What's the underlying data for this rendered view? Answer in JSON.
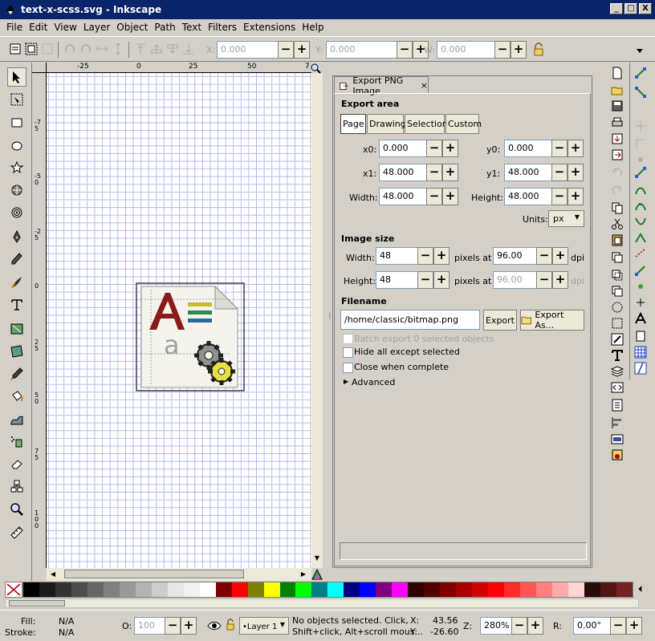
{
  "window": {
    "title": "text-x-scss.svg - Inkscape",
    "min": "_",
    "max": "□",
    "close": "X"
  },
  "menu": [
    "File",
    "Edit",
    "View",
    "Layer",
    "Object",
    "Path",
    "Text",
    "Filters",
    "Extensions",
    "Help"
  ],
  "control_bar": {
    "x_label": "X:",
    "x_value": "0.000",
    "y_label": "Y:",
    "y_value": "0.000",
    "w_label": "W:",
    "w_value": "0.000"
  },
  "ruler": {
    "h_ticks": [
      "-25",
      "0",
      "25",
      "50",
      "7"
    ],
    "v_ticks": [
      "-75",
      "-50",
      "-25",
      "0",
      "25",
      "50",
      "75",
      "100"
    ]
  },
  "tools": [
    "selector-tool",
    "node-tool",
    "rect-tool",
    "ellipse-tool",
    "star-tool",
    "3dbox-tool",
    "spiral-tool",
    "pencil-tool",
    "pen-tool",
    "calligraphy-tool",
    "text-tool",
    "gradient-tool",
    "mesh-tool",
    "dropper-tool",
    "paint-bucket-tool",
    "tweak-tool",
    "spray-tool",
    "eraser-tool",
    "connector-tool",
    "zoom-tool",
    "measure-tool"
  ],
  "dialog": {
    "tab_label": "Export PNG Image",
    "tab_close": "×",
    "export_area": {
      "heading": "Export area",
      "buttons": [
        "Page",
        "Drawing",
        "Selection",
        "Custom"
      ],
      "active": "Page",
      "x0_label": "x0:",
      "x0": "0.000",
      "y0_label": "y0:",
      "y0": "0.000",
      "x1_label": "x1:",
      "x1": "48.000",
      "y1_label": "y1:",
      "y1": "48.000",
      "width_label": "Width:",
      "width": "48.000",
      "height_label": "Height:",
      "height": "48.000",
      "units_label": "Units:",
      "units": "px"
    },
    "image_size": {
      "heading": "Image size",
      "width_label": "Width:",
      "width": "48",
      "height_label": "Height:",
      "height": "48",
      "pixels_at": "pixels at",
      "dpi_x": "96.00",
      "dpi_y": "96.00",
      "dpi": "dpi"
    },
    "filename": {
      "heading": "Filename",
      "value": "/home/classic/bitmap.png",
      "export_btn": "Export",
      "export_as_btn": "Export As..."
    },
    "options": {
      "batch": "Batch export 0 selected objects",
      "hide": "Hide all except selected",
      "close": "Close when complete",
      "advanced": "Advanced"
    }
  },
  "palette": [
    "#000000",
    "#1a1a1a",
    "#333333",
    "#4d4d4d",
    "#666666",
    "#808080",
    "#999999",
    "#b3b3b3",
    "#cccccc",
    "#e6e6e6",
    "#f2f2f2",
    "#ffffff",
    "#800000",
    "#ff0000",
    "#808000",
    "#ffff00",
    "#008000",
    "#00ff00",
    "#008080",
    "#00ffff",
    "#000080",
    "#0000ff",
    "#800080",
    "#ff00ff",
    "#2b0000",
    "#550000",
    "#800000",
    "#aa0000",
    "#d40000",
    "#ff0000",
    "#ff2a2a",
    "#ff5555",
    "#ff8080",
    "#ffaaaa",
    "#ffd5d5",
    "#280b0b",
    "#501616",
    "#782121"
  ],
  "status": {
    "fill_label": "Fill:",
    "fill_value": "N/A",
    "stroke_label": "Stroke:",
    "stroke_value": "N/A",
    "opacity_label": "O:",
    "opacity_value": "100",
    "layer": "•Layer 1",
    "message_line1": "No objects selected. Click,",
    "message_line2": "Shift+click, Alt+scroll mous...",
    "x_label": "X:",
    "x_value": "43.56",
    "y_label": "Y:",
    "y_value": "-26.60",
    "zoom_label": "Z:",
    "zoom_value": "280%",
    "rotate_label": "R:",
    "rotate_value": "0.00°"
  }
}
